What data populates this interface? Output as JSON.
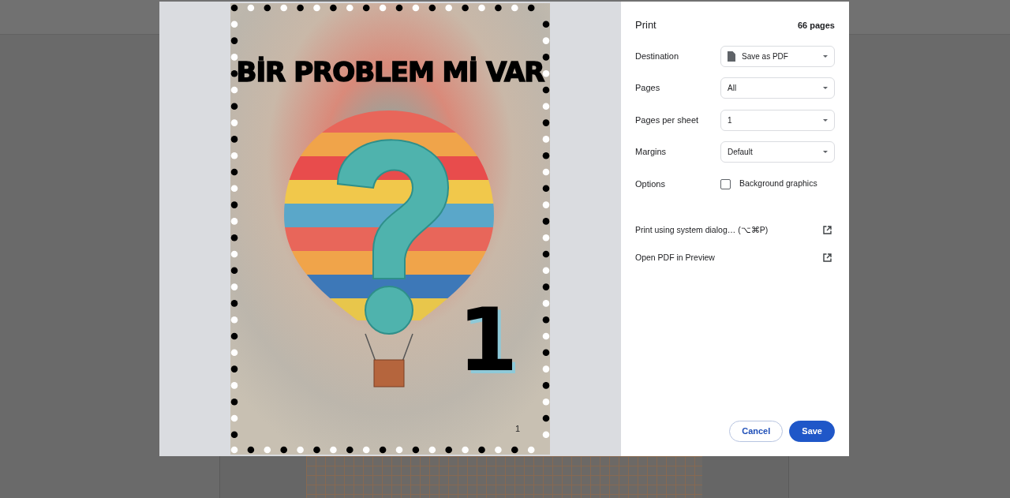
{
  "preview": {
    "title": "BİR PROBLEM Mİ VAR",
    "big_number": "1",
    "page_number": "1"
  },
  "panel": {
    "title": "Print",
    "page_count": "66 pages",
    "settings": [
      {
        "kind": "select",
        "label": "Destination",
        "value": "Save as PDF"
      },
      {
        "kind": "select",
        "label": "Pages",
        "value": "All"
      },
      {
        "kind": "select",
        "label": "Pages per sheet",
        "value": "1"
      },
      {
        "kind": "select",
        "label": "Margins",
        "value": "Default"
      },
      {
        "kind": "checkbox",
        "label": "Options",
        "text": "Background graphics",
        "checked": false
      }
    ],
    "links": [
      {
        "label": "Print using system dialog… (⌥⌘P)"
      },
      {
        "label": "Open PDF in Preview"
      }
    ],
    "buttons": [
      {
        "label": "Cancel",
        "kind": "secondary"
      },
      {
        "label": "Save",
        "kind": "primary"
      }
    ]
  }
}
